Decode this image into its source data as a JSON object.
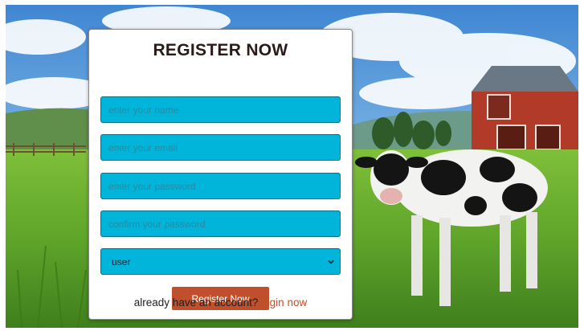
{
  "form": {
    "title": "REGISTER NOW",
    "name_placeholder": "enter your name",
    "email_placeholder": "enter your email",
    "password_placeholder": "enter your password",
    "confirm_placeholder": "confirm your password",
    "user_type_value": "user",
    "submit_label": "Register Now",
    "login_prompt": "already have an account?",
    "login_link_label": "login now"
  },
  "colors": {
    "field_background": "#00b4da",
    "button_background": "#c0502b",
    "link_color": "#c0502b"
  },
  "icons": {
    "select_arrow": "chevron-down-icon"
  }
}
